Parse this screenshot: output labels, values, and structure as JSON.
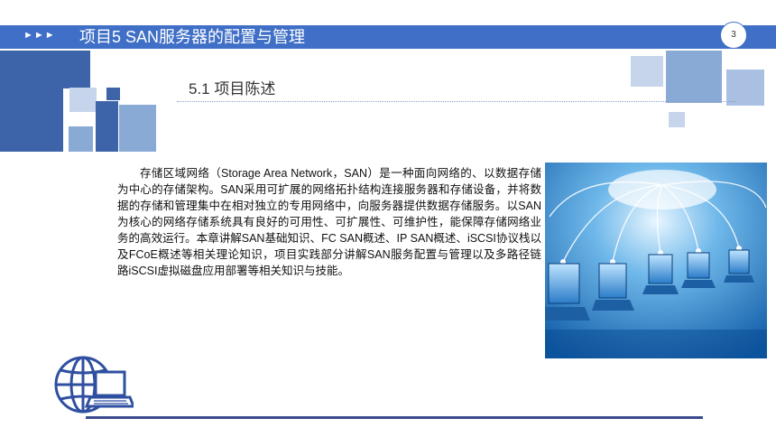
{
  "header": {
    "arrows": "►►►",
    "title": "项目5 SAN服务器的配置与管理",
    "page_number": "3"
  },
  "section": {
    "title": "5.1  项目陈述"
  },
  "body": {
    "paragraph": "存储区域网络（Storage Area Network，SAN）是一种面向网络的、以数据存储为中心的存储架构。SAN采用可扩展的网络拓扑结构连接服务器和存储设备，并将数据的存储和管理集中在相对独立的专用网络中，向服务器提供数据存储服务。以SAN为核心的网络存储系统具有良好的可用性、可扩展性、可维护性，能保障存储网络业务的高效运行。本章讲解SAN基础知识、FC SAN概述、IP SAN概述、iSCSI协议栈以及FCoE概述等相关理论知识，项目实践部分讲解SAN服务配置与管理以及多路径链路iSCSI虚拟磁盘应用部署等相关知识与技能。"
  },
  "colors": {
    "header_blue": "#3f6fc6",
    "dark_square": "#3d64a8",
    "mid_square": "#8aaad6",
    "light_square": "#c6d5ec",
    "bottom_line": "#3c4a8e"
  },
  "icons": {
    "photo": "network-laptops-photo",
    "logo": "globe-laptop-icon"
  }
}
